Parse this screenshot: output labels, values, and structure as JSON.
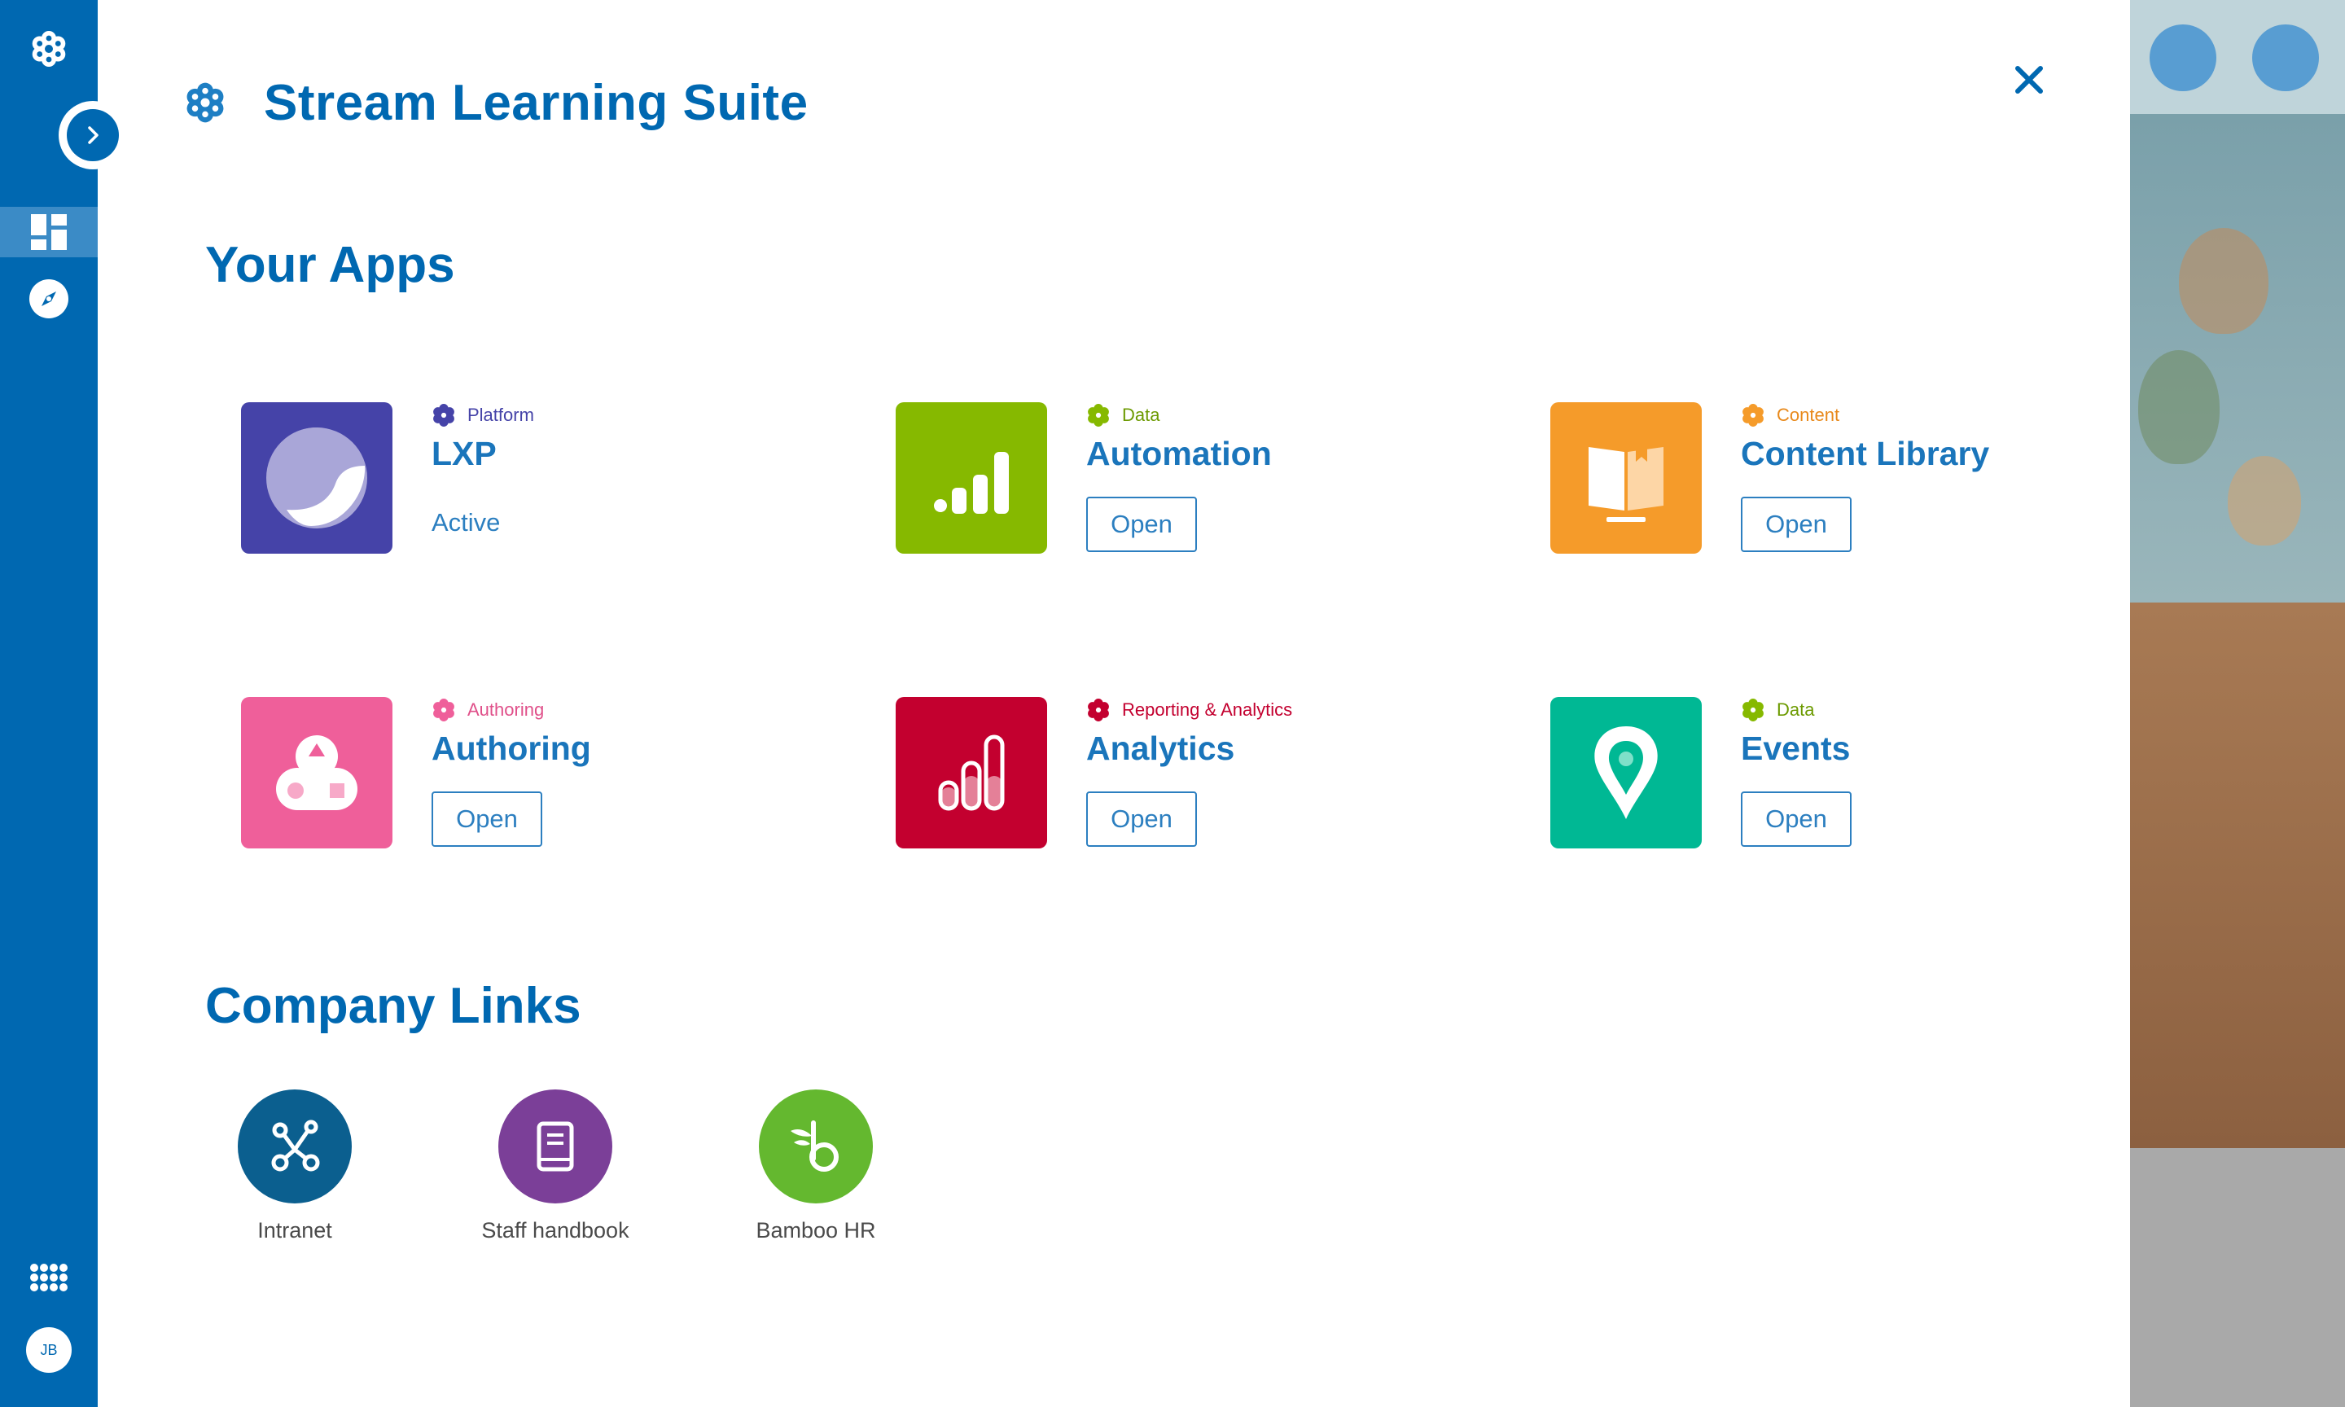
{
  "suite": {
    "title": "Stream Learning Suite"
  },
  "sidebar": {
    "user_initials": "JB"
  },
  "apps_section": {
    "title": "Your Apps",
    "apps": [
      {
        "category": "Platform",
        "name": "LXP",
        "status": "Active",
        "tile_color": "#4543a8",
        "category_color": "#4543a8",
        "icon": "lxp-swoosh-icon"
      },
      {
        "category": "Data",
        "name": "Automation",
        "button": "Open",
        "tile_color": "#86b900",
        "category_color": "#86b900",
        "icon": "automation-bars-icon"
      },
      {
        "category": "Content",
        "name": "Content Library",
        "button": "Open",
        "tile_color": "#f59b2a",
        "category_color": "#f59b2a",
        "icon": "open-book-icon"
      },
      {
        "category": "Authoring",
        "name": "Authoring",
        "button": "Open",
        "tile_color": "#ef5f9a",
        "category_color": "#ef5f9a",
        "icon": "shapes-icon"
      },
      {
        "category": "Reporting & Analytics",
        "name": "Analytics",
        "button": "Open",
        "tile_color": "#c3002f",
        "category_color": "#c3002f",
        "icon": "analytics-bars-icon"
      },
      {
        "category": "Data",
        "name": "Events",
        "button": "Open",
        "tile_color": "#00b894",
        "category_color": "#86b900",
        "icon": "map-pin-icon"
      }
    ]
  },
  "links_section": {
    "title": "Company Links",
    "links": [
      {
        "label": "Intranet",
        "color": "#0b5f8f",
        "icon": "network-icon"
      },
      {
        "label": "Staff handbook",
        "color": "#7b3f98",
        "icon": "book-icon"
      },
      {
        "label": "Bamboo HR",
        "color": "#64b82f",
        "icon": "bamboo-icon"
      }
    ]
  }
}
